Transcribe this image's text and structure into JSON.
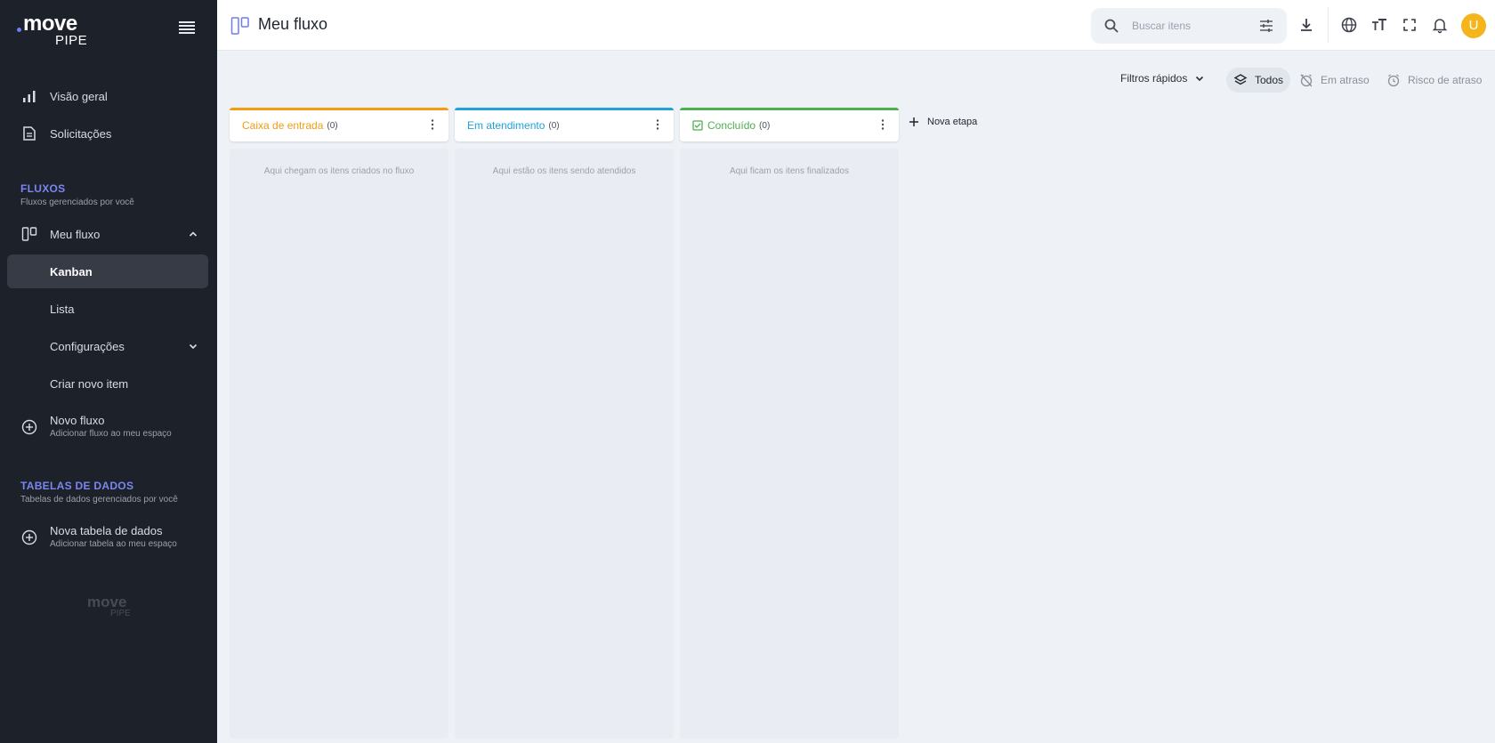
{
  "brand": {
    "logo_word": "move",
    "logo_sub": "PIPE"
  },
  "sidebar": {
    "overview_label": "Visão geral",
    "requests_label": "Solicitações",
    "flows_section": {
      "title": "FLUXOS",
      "subtitle": "Fluxos gerenciados por você"
    },
    "flow": {
      "label": "Meu fluxo",
      "items": [
        {
          "label": "Kanban",
          "active": true
        },
        {
          "label": "Lista"
        },
        {
          "label": "Configurações"
        },
        {
          "label": "Criar novo item"
        }
      ]
    },
    "new_flow": {
      "label": "Novo fluxo",
      "sub": "Adicionar fluxo ao meu espaço"
    },
    "tables_section": {
      "title": "TABELAS DE DADOS",
      "subtitle": "Tabelas de dados gerenciados por você"
    },
    "new_table": {
      "label": "Nova tabela de dados",
      "sub": "Adicionar tabela ao meu espaço"
    }
  },
  "header": {
    "title": "Meu fluxo",
    "search_placeholder": "Buscar itens",
    "avatar_initial": "U"
  },
  "filters": {
    "quick_label": "Filtros rápidos",
    "chips": [
      "Todos",
      "Em atraso",
      "Risco de atraso"
    ]
  },
  "columns": [
    {
      "title": "Caixa de entrada",
      "count": "(0)",
      "color": "#f39c12",
      "empty": "Aqui chegam os itens criados no fluxo"
    },
    {
      "title": "Em atendimento",
      "count": "(0)",
      "color": "#1fa2d8",
      "empty": "Aqui estão os itens sendo atendidos"
    },
    {
      "title": "Concluído",
      "count": "(0)",
      "color": "#4caf50",
      "empty": "Aqui ficam os itens finalizados"
    }
  ],
  "new_stage_label": "Nova etapa",
  "colors": {
    "sidebar_bg": "#1d2129",
    "accent": "#7b86f0",
    "avatar": "#f5b51c"
  }
}
